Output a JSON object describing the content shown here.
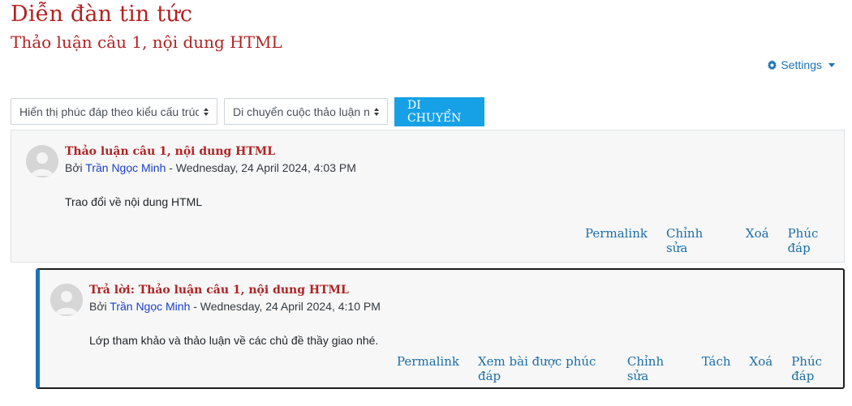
{
  "page": {
    "title": "Diễn đàn tin tức",
    "subtitle": "Thảo luận câu 1, nội dung HTML"
  },
  "settings": {
    "label": "Settings",
    "icon": "gear-icon"
  },
  "toolbar": {
    "display_select": "Hiển thị phúc đáp theo kiểu cấu trúc",
    "move_select": "Di chuyển cuộc thảo luận này",
    "move_button": "DI CHUYỂN"
  },
  "posts": [
    {
      "subject": "Thảo luận câu 1, nội dung HTML",
      "by_prefix": "Bởi",
      "author": "Trần Ngọc Minh",
      "date": " - Wednesday, 24 April 2024, 4:03 PM",
      "body": "Trao đổi về nội dung HTML",
      "actions": [
        "Permalink",
        "Chỉnh sửa",
        "Xoá",
        "Phúc đáp"
      ]
    },
    {
      "subject": "Trả lời: Thảo luận câu 1, nội dung HTML",
      "by_prefix": "Bởi",
      "author": "Trần Ngọc Minh",
      "date": " - Wednesday, 24 April 2024, 4:10 PM",
      "body": "Lớp tham khảo và thảo luận về các chủ đề thầy giao nhé.",
      "actions": [
        "Permalink",
        "Xem bài được phúc đáp",
        "Chỉnh sửa",
        "Tách",
        "Xoá",
        "Phúc đáp"
      ]
    }
  ],
  "colors": {
    "title": "#b22222",
    "link": "#1a73b8",
    "button": "#16a1e7",
    "author": "#1a3fc8"
  }
}
